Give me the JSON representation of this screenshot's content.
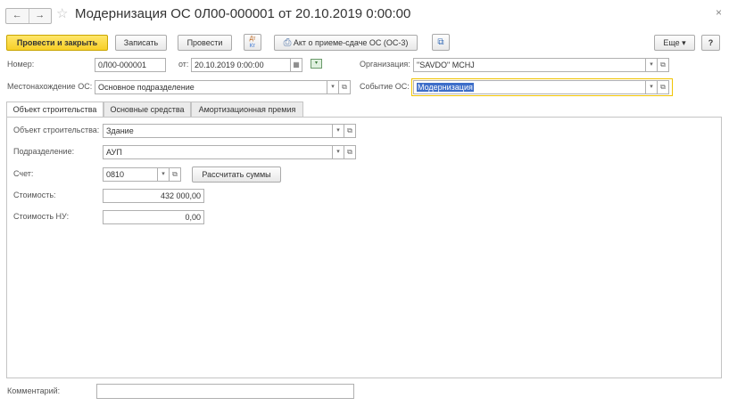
{
  "header": {
    "back": "←",
    "forward": "→",
    "star": "☆",
    "title": "Модернизация ОС 0Л00-000001 от 20.10.2019 0:00:00",
    "close": "×"
  },
  "toolbar": {
    "post_close": "Провести и закрыть",
    "save": "Записать",
    "post": "Провести",
    "dt_kt_top": "Дт",
    "dt_kt_bottom": "Кт",
    "print_act": "Акт о приеме-сдаче ОС (ОС-3)",
    "more": "Еще ▾",
    "help": "?"
  },
  "form": {
    "number_label": "Номер:",
    "number_value": "0Л00-000001",
    "date_label": "от:",
    "date_value": "20.10.2019  0:00:00",
    "org_label": "Организация:",
    "org_value": "\"SAVDO\" MCHJ",
    "location_label": "Местонахождение ОС:",
    "location_value": "Основное подразделение",
    "event_label": "Событие ОС:",
    "event_value": "Модернизация"
  },
  "tabs": [
    {
      "label": "Объект строительства"
    },
    {
      "label": "Основные средства"
    },
    {
      "label": "Амортизационная премия"
    }
  ],
  "panel": {
    "object_label": "Объект строительства:",
    "object_value": "Здание",
    "division_label": "Подразделение:",
    "division_value": "АУП",
    "account_label": "Счет:",
    "account_value": "0810",
    "calc_button": "Рассчитать суммы",
    "cost_label": "Стоимость:",
    "cost_value": "432 000,00",
    "cost_nu_label": "Стоимость НУ:",
    "cost_nu_value": "0,00"
  },
  "comment": {
    "label": "Комментарий:",
    "value": ""
  },
  "glyphs": {
    "dropdown": "▾",
    "open": "⧉",
    "calendar": "▦",
    "print": "⎙"
  },
  "colors": {
    "accent_yellow": "#f7cf27",
    "selection_blue": "#3d6ec9",
    "focus_border": "#f0c400"
  }
}
